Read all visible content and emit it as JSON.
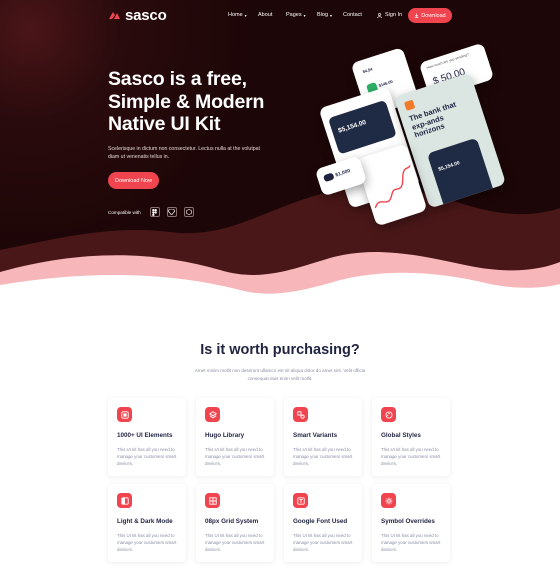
{
  "brand": {
    "name": "sasco",
    "accent": "#f0454f",
    "hero_bg": "#1d0607"
  },
  "nav": {
    "links": [
      {
        "label": "Home",
        "caret": true
      },
      {
        "label": "About",
        "caret": false
      },
      {
        "label": "Pages",
        "caret": true
      },
      {
        "label": "Blog",
        "caret": true
      },
      {
        "label": "Contact",
        "caret": false
      }
    ],
    "signin_label": "Sign In",
    "download_label": "Download"
  },
  "hero": {
    "title_line1": "Sasco is a free,",
    "title_line2": "Simple & Modern",
    "title_line3": "Native UI Kit",
    "subtitle": "Scelerisque in dictum non consectetur. Lectus nulla at the volutpat diam ut venenatis tellus in.",
    "cta_label": "Download Now",
    "compatible_label": "Compatible with",
    "compatible_icons": [
      "figma-icon",
      "sketch-icon",
      "adobe-xd-icon"
    ]
  },
  "mockups": {
    "balance_label": "$4,54",
    "balance_amount": "$146.00",
    "transfer_title": "How much are you sending?",
    "transfer_amount": "$ 50.00",
    "card_amount": "$5,154.00",
    "promo_title": "The bank that exp-ands horizons",
    "phone_amount": "$5,154.00",
    "small_amount": "$1,000"
  },
  "features": {
    "title": "Is it worth purchasing?",
    "subtitle": "Amet minim mollit non deserunt ullamco est sit aliqua dolor do amet sint. Velit officia consequat duis enim velit mollit.",
    "items": [
      {
        "title": "1000+ UI Elements",
        "text": "This UI kit has all you need to manage your customers smart devices.",
        "icon": "layers-icon"
      },
      {
        "title": "Hugo Library",
        "text": "This UI kit has all you need to manage your customers smart devices.",
        "icon": "stack-icon"
      },
      {
        "title": "Smart Variants",
        "text": "This UI kit has all you need to manage your customers smart devices.",
        "icon": "shapes-icon"
      },
      {
        "title": "Global Styles",
        "text": "This UI kit has all you need to manage your customers smart devices.",
        "icon": "palette-icon"
      },
      {
        "title": "Light & Dark Mode",
        "text": "This UI kit has all you need to manage your customers smart devices.",
        "icon": "contrast-icon"
      },
      {
        "title": "08px Grid System",
        "text": "This UI kit has all you need to manage your customers smart devices.",
        "icon": "grid-icon"
      },
      {
        "title": "Google Font Used",
        "text": "This UI kit has all you need to manage your customers smart devices.",
        "icon": "font-icon"
      },
      {
        "title": "Symbol Overrides",
        "text": "This UI kit has all you need to manage your customers smart devices.",
        "icon": "gear-icon"
      }
    ]
  }
}
